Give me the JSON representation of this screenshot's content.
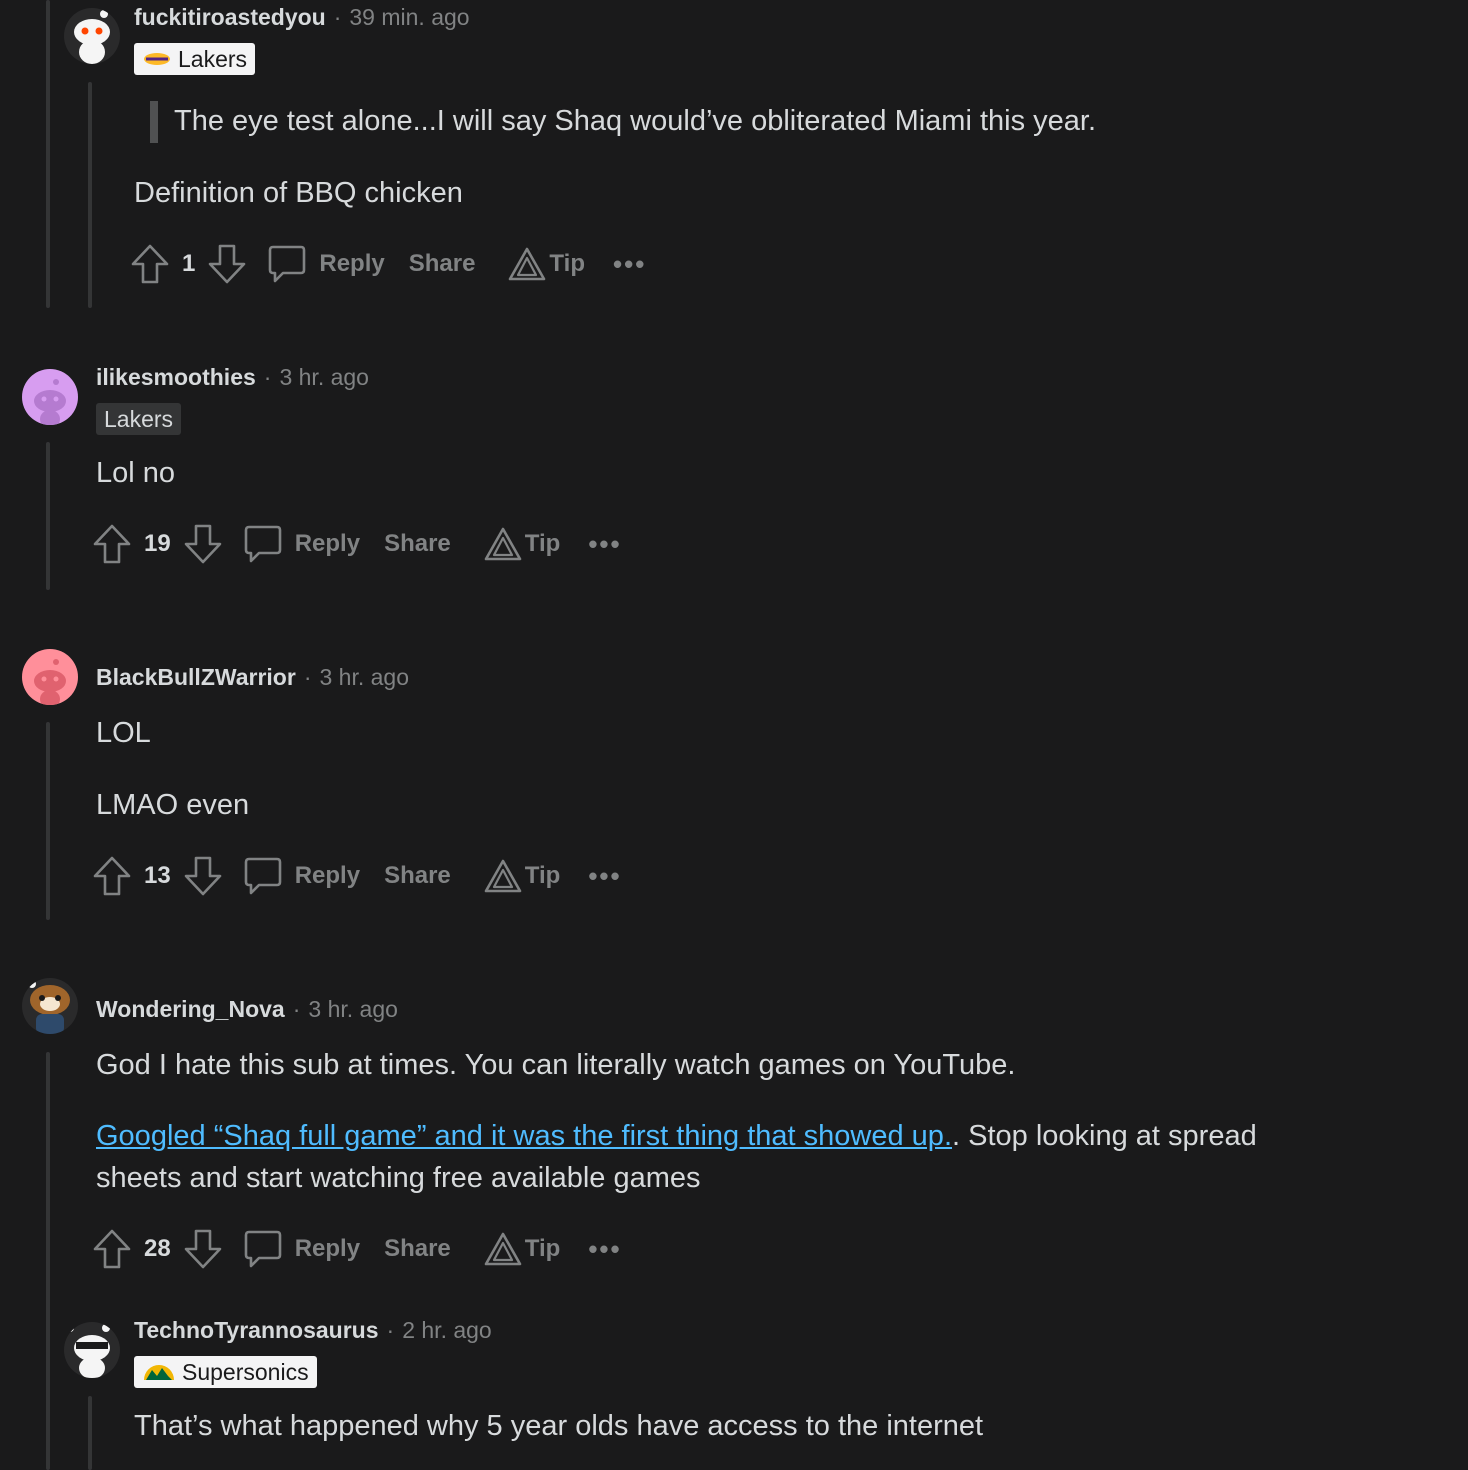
{
  "comments": [
    {
      "author": "fuckitiroastedyou",
      "time": "39 min. ago",
      "flair": "Lakers",
      "quote": "The eye test alone...I will say Shaq would’ve obliterated Miami this year.",
      "paragraphs": [
        "Definition of BBQ chicken"
      ],
      "score": "1"
    },
    {
      "author": "ilikesmoothies",
      "time": "3 hr. ago",
      "flair": "Lakers",
      "paragraphs": [
        "Lol no"
      ],
      "score": "19"
    },
    {
      "author": "BlackBullZWarrior",
      "time": "3 hr. ago",
      "paragraphs": [
        "LOL",
        "LMAO even"
      ],
      "score": "13"
    },
    {
      "author": "Wondering_Nova",
      "time": "3 hr. ago",
      "paragraphs": [
        "God I hate this sub at times. You can literally watch games on YouTube."
      ],
      "link_text": "Googled “Shaq full game” and it was the first thing that showed up.",
      "link_tail": ". Stop looking at spread",
      "continuation": "sheets and start watching free available games",
      "score": "28"
    },
    {
      "author": "TechnoTyrannosaurus",
      "time": "2 hr. ago",
      "flair": "Supersonics",
      "paragraphs": [
        "That’s what happened why 5 year olds have access to the internet"
      ]
    }
  ],
  "actions": {
    "reply": "Reply",
    "share": "Share",
    "tip": "Tip",
    "more": "•••",
    "separator": "·"
  },
  "colors": {
    "background": "#1a1a1b",
    "text": "#d7dadc",
    "muted": "#818384",
    "link": "#4fbcff",
    "thread_line": "#343536"
  }
}
